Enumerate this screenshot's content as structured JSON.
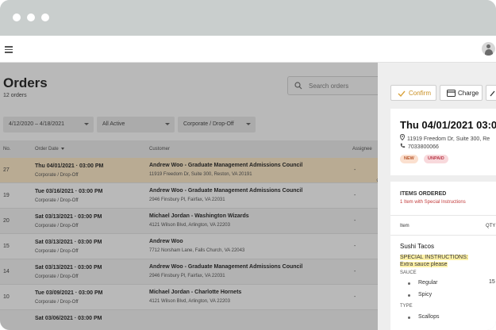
{
  "page": {
    "title": "Orders",
    "subtitle": "12 orders",
    "search_placeholder": "Search orders"
  },
  "filters": {
    "date_range": "4/12/2020 – 4/18/2021",
    "status": "All Active",
    "type": "Corporate / Drop-Off"
  },
  "table": {
    "columns": {
      "no": "No.",
      "order_date": "Order Date",
      "customer": "Customer",
      "assignee": "Assignee"
    },
    "rows": [
      {
        "no": "27",
        "date": "Thu 04/01/2021  ·  03:00 PM",
        "service": "Corporate / Drop-Off",
        "customer": "Andrew Woo - Graduate Management Admissions Council",
        "address": "11919 Freedom Dr, Suite 300, Reston, VA 20191",
        "assignee": "-"
      },
      {
        "no": "19",
        "date": "Tue 03/16/2021  ·  03:00 PM",
        "service": "Corporate / Drop-Off",
        "customer": "Andrew Woo - Graduate Management Admissions Council",
        "address": "2946 Finsbury Pl, Fairfax, VA 22031",
        "assignee": "-"
      },
      {
        "no": "20",
        "date": "Sat 03/13/2021  ·  03:00 PM",
        "service": "Corporate / Drop-Off",
        "customer": "Michael Jordan - Washington Wizards",
        "address": "4121 Wilson Blvd, Arlington, VA 22203",
        "assignee": "-"
      },
      {
        "no": "15",
        "date": "Sat 03/13/2021  ·  03:00 PM",
        "service": "Corporate / Drop-Off",
        "customer": "Andrew Woo",
        "address": "7712 Norsham Lane, Falls Church, VA 22043",
        "assignee": "-"
      },
      {
        "no": "14",
        "date": "Sat 03/13/2021  ·  03:00 PM",
        "service": "Corporate / Drop-Off",
        "customer": "Andrew Woo - Graduate Management Admissions Council",
        "address": "2946 Finsbury Pl, Fairfax, VA 22031",
        "assignee": "-"
      },
      {
        "no": "10",
        "date": "Tue 03/09/2021  ·  03:00 PM",
        "service": "Corporate / Drop-Off",
        "customer": "Michael Jordan - Charlotte Hornets",
        "address": "4121 Wilson Blvd, Arlington, VA 22203",
        "assignee": "-"
      },
      {
        "no": "",
        "date": "Sat 03/06/2021  ·  03:00 PM",
        "service": "",
        "customer": "",
        "address": "",
        "assignee": ""
      }
    ]
  },
  "panel": {
    "confirm_label": "Confirm",
    "charge_label": "Charge",
    "order_date": "Thu 04/01/2021 03:0",
    "address": "11919 Freedom Dr, Suite 300, Re",
    "phone": "7033800066",
    "badge_new": "NEW",
    "badge_unpaid": "UNPAID",
    "items_title": "ITEMS ORDERED",
    "items_sub": "1 Item with Special Instructions",
    "col_item": "Item",
    "col_qty": "QTY",
    "item_name": "Sushi Tacos",
    "special_label": "SPECIAL INSTRUCTIONS:",
    "special_text": "Extra sauce please",
    "sauce_header": "SAUCE",
    "sauce_options": [
      "Regular",
      "Spicy"
    ],
    "sauce_qty": "15",
    "type_header": "TYPE",
    "type_options": [
      "Scallops"
    ]
  },
  "colors": {
    "selected_row": "#ffe9c4",
    "confirm_accent": "#d9a23a",
    "badge_new": "#fbe0cf",
    "badge_unpaid": "#f8d9dc"
  }
}
